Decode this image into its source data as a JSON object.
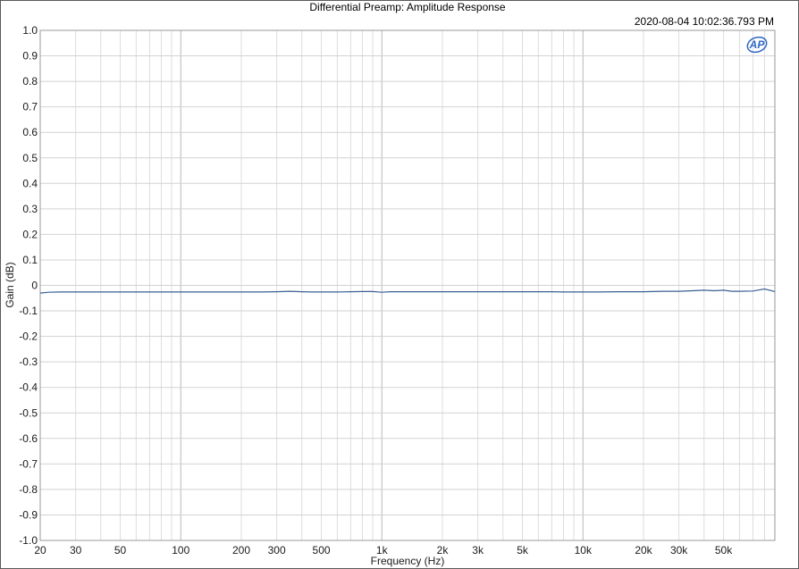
{
  "chart_data": {
    "type": "line",
    "title": "Differential Preamp: Amplitude Response",
    "timestamp": "2020-08-04 10:02:36.793 PM",
    "logo": "AP",
    "xlabel": "Frequency (Hz)",
    "ylabel": "Gain (dB)",
    "x_scale": "log",
    "xlim": [
      20,
      90000
    ],
    "ylim": [
      -1.0,
      1.0
    ],
    "grid": true,
    "line_color": "#3a5f95",
    "x_ticks": [
      {
        "v": 20,
        "label": "20"
      },
      {
        "v": 30,
        "label": "30"
      },
      {
        "v": 50,
        "label": "50"
      },
      {
        "v": 100,
        "label": "100"
      },
      {
        "v": 200,
        "label": "200"
      },
      {
        "v": 300,
        "label": "300"
      },
      {
        "v": 500,
        "label": "500"
      },
      {
        "v": 1000,
        "label": "1k"
      },
      {
        "v": 2000,
        "label": "2k"
      },
      {
        "v": 3000,
        "label": "3k"
      },
      {
        "v": 5000,
        "label": "5k"
      },
      {
        "v": 10000,
        "label": "10k"
      },
      {
        "v": 20000,
        "label": "20k"
      },
      {
        "v": 30000,
        "label": "30k"
      },
      {
        "v": 50000,
        "label": "50k"
      }
    ],
    "y_ticks": [
      {
        "v": 1.0,
        "label": "1.0"
      },
      {
        "v": 0.9,
        "label": "0.9"
      },
      {
        "v": 0.8,
        "label": "0.8"
      },
      {
        "v": 0.7,
        "label": "0.7"
      },
      {
        "v": 0.6,
        "label": "0.6"
      },
      {
        "v": 0.5,
        "label": "0.5"
      },
      {
        "v": 0.4,
        "label": "0.4"
      },
      {
        "v": 0.3,
        "label": "0.3"
      },
      {
        "v": 0.2,
        "label": "0.2"
      },
      {
        "v": 0.1,
        "label": "0.1"
      },
      {
        "v": 0,
        "label": "0"
      },
      {
        "v": -0.1,
        "label": "-0.1"
      },
      {
        "v": -0.2,
        "label": "-0.2"
      },
      {
        "v": -0.3,
        "label": "-0.3"
      },
      {
        "v": -0.4,
        "label": "-0.4"
      },
      {
        "v": -0.5,
        "label": "-0.5"
      },
      {
        "v": -0.6,
        "label": "-0.6"
      },
      {
        "v": -0.7,
        "label": "-0.7"
      },
      {
        "v": -0.8,
        "label": "-0.8"
      },
      {
        "v": -0.9,
        "label": "-0.9"
      },
      {
        "v": -1.0,
        "label": "-1.0"
      }
    ],
    "series": [
      {
        "x": [
          20,
          22,
          25,
          30,
          40,
          50,
          70,
          100,
          150,
          200,
          250,
          300,
          350,
          400,
          450,
          500,
          600,
          700,
          800,
          900,
          1000,
          1100,
          1200,
          1500,
          2000,
          3000,
          5000,
          7000,
          8000,
          10000,
          12000,
          15000,
          20000,
          25000,
          30000,
          35000,
          40000,
          45000,
          50000,
          55000,
          60000,
          70000,
          80000,
          90000
        ],
        "y": [
          -0.03,
          -0.027,
          -0.026,
          -0.026,
          -0.026,
          -0.026,
          -0.026,
          -0.026,
          -0.026,
          -0.026,
          -0.026,
          -0.025,
          -0.023,
          -0.025,
          -0.026,
          -0.026,
          -0.026,
          -0.025,
          -0.024,
          -0.024,
          -0.027,
          -0.025,
          -0.025,
          -0.025,
          -0.025,
          -0.025,
          -0.025,
          -0.025,
          -0.026,
          -0.026,
          -0.026,
          -0.025,
          -0.025,
          -0.023,
          -0.023,
          -0.021,
          -0.019,
          -0.021,
          -0.019,
          -0.023,
          -0.023,
          -0.022,
          -0.014,
          -0.024
        ]
      }
    ]
  }
}
